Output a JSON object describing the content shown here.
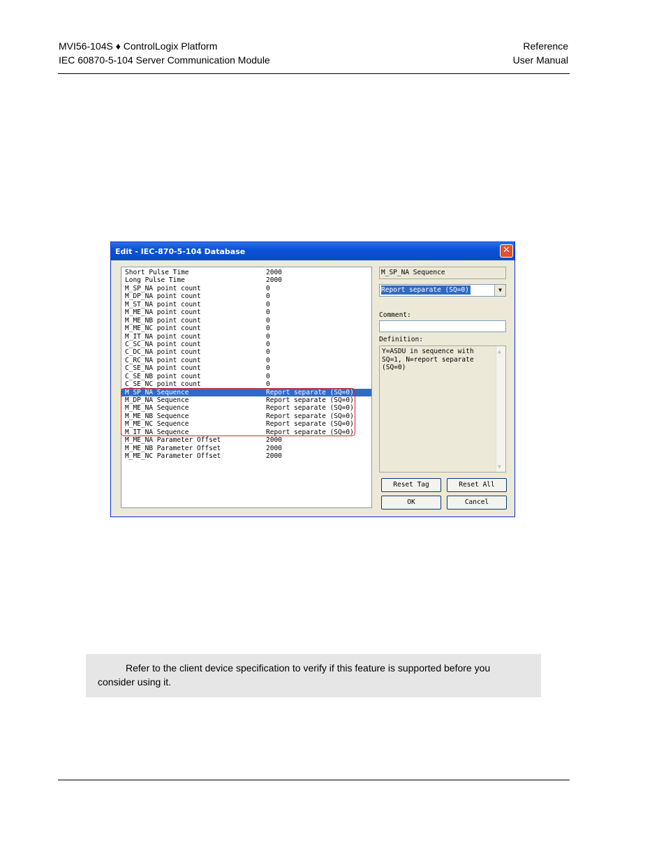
{
  "header": {
    "left_line1": "MVI56-104S ♦ ControlLogix Platform",
    "left_line2": "IEC 60870-5-104 Server Communication Module",
    "right_line1": "Reference",
    "right_line2": "User Manual"
  },
  "dialog": {
    "title": "Edit - IEC-870-5-104 Database",
    "close_label": "✕",
    "rows": [
      {
        "key": "Short Pulse Time",
        "value": "2000"
      },
      {
        "key": "Long Pulse Time",
        "value": "2000"
      },
      {
        "key": "M_SP_NA point count",
        "value": "0"
      },
      {
        "key": "M_DP_NA point count",
        "value": "0"
      },
      {
        "key": "M_ST_NA point count",
        "value": "0"
      },
      {
        "key": "M_ME_NA point count",
        "value": "0"
      },
      {
        "key": "M_ME_NB point count",
        "value": "0"
      },
      {
        "key": "M_ME_NC point count",
        "value": "0"
      },
      {
        "key": "M_IT_NA point count",
        "value": "0"
      },
      {
        "key": "C_SC_NA point count",
        "value": "0"
      },
      {
        "key": "C_DC_NA point count",
        "value": "0"
      },
      {
        "key": "C_RC_NA point count",
        "value": "0"
      },
      {
        "key": "C_SE_NA point count",
        "value": "0"
      },
      {
        "key": "C_SE_NB point count",
        "value": "0"
      },
      {
        "key": "C_SE_NC point count",
        "value": "0"
      },
      {
        "key": "M_SP_NA Sequence",
        "value": "Report separate (SQ=0)"
      },
      {
        "key": "M_DP_NA Sequence",
        "value": "Report separate (SQ=0)"
      },
      {
        "key": "M_ME_NA Sequence",
        "value": "Report separate (SQ=0)"
      },
      {
        "key": "M_ME_NB Sequence",
        "value": "Report separate (SQ=0)"
      },
      {
        "key": "M_ME_NC Sequence",
        "value": "Report separate (SQ=0)"
      },
      {
        "key": "M_IT_NA Sequence",
        "value": "Report separate (SQ=0)"
      },
      {
        "key": "M_ME_NA Parameter Offset",
        "value": "2000"
      },
      {
        "key": "M_ME_NB Parameter Offset",
        "value": "2000"
      },
      {
        "key": "M_ME_NC Parameter Offset",
        "value": "2000"
      }
    ],
    "selected_index": 15,
    "tag_name": "M_SP_NA Sequence",
    "combo_value": "Report separate (SQ=0)",
    "comment_label": "Comment:",
    "comment_value": "",
    "definition_label": "Definition:",
    "definition_text": "Y=ASDU in sequence with SQ=1, N=report separate (SQ=0)",
    "buttons": {
      "reset_tag": "Reset Tag",
      "reset_all": "Reset All",
      "ok": "OK",
      "cancel": "Cancel"
    }
  },
  "note": {
    "text_line1": "Refer to the client device specification to verify if this feature is supported before you",
    "text_line2": "consider using it."
  }
}
